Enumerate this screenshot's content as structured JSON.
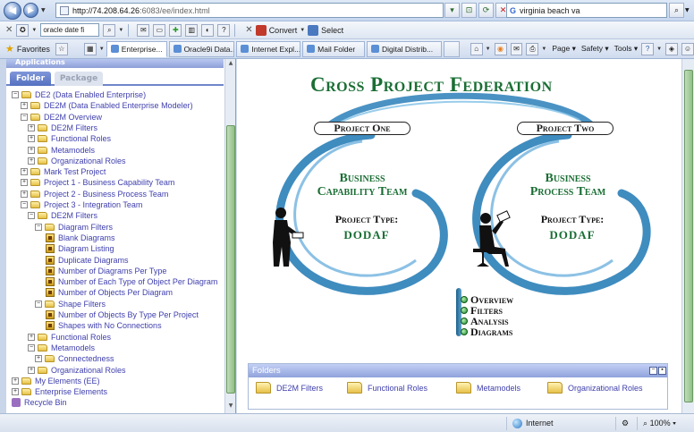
{
  "browser": {
    "address": {
      "host": "http://74.208.64.26",
      "rest": ":6083/ee/index.html"
    },
    "search_value": "virginia beach va",
    "search_logo": "G",
    "toolbar": {
      "search_value": "oracle date fi",
      "convert_label": "Convert",
      "select_label": "Select"
    },
    "favorites_label": "Favorites",
    "tabs": [
      {
        "label": "Enterprise...",
        "active": true
      },
      {
        "label": "Oracle9i Data..."
      },
      {
        "label": "Internet Expl..."
      },
      {
        "label": "Mail Folder"
      },
      {
        "label": "Digital Distrib..."
      }
    ],
    "commands": {
      "page": "Page",
      "safety": "Safety",
      "tools": "Tools"
    },
    "status": {
      "zone": "Internet",
      "zoom": "100%"
    }
  },
  "left_panel": {
    "header": "Applications",
    "tabs": {
      "folder": "Folder",
      "package": "Package"
    },
    "tree": [
      {
        "label": "DE2 (Data Enabled Enterprise)",
        "level": 0,
        "exp": "−",
        "icon": "folder"
      },
      {
        "label": "DE2M (Data Enabled Enterprise Modeler)",
        "level": 1,
        "exp": "+",
        "icon": "folder"
      },
      {
        "label": "DE2M Overview",
        "level": 1,
        "exp": "−",
        "icon": "folder"
      },
      {
        "label": "DE2M Filters",
        "level": 2,
        "exp": "+",
        "icon": "folder"
      },
      {
        "label": "Functional Roles",
        "level": 2,
        "exp": "+",
        "icon": "folder"
      },
      {
        "label": "Metamodels",
        "level": 2,
        "exp": "+",
        "icon": "folder"
      },
      {
        "label": "Organizational Roles",
        "level": 2,
        "exp": "+",
        "icon": "folder"
      },
      {
        "label": "Mark Test Project",
        "level": 1,
        "exp": "+",
        "icon": "folder"
      },
      {
        "label": "Project 1 - Business Capability Team",
        "level": 1,
        "exp": "+",
        "icon": "folder"
      },
      {
        "label": "Project 2 - Business Process Team",
        "level": 1,
        "exp": "+",
        "icon": "folder"
      },
      {
        "label": "Project 3 - Integration Team",
        "level": 1,
        "exp": "−",
        "icon": "folder"
      },
      {
        "label": "DE2M Filters",
        "level": 2,
        "exp": "−",
        "icon": "folder"
      },
      {
        "label": "Diagram Filters",
        "level": 3,
        "exp": "−",
        "icon": "folder"
      },
      {
        "label": "Blank Diagrams",
        "level": 4,
        "exp": "",
        "icon": "report"
      },
      {
        "label": "Diagram Listing",
        "level": 4,
        "exp": "",
        "icon": "report"
      },
      {
        "label": "Duplicate Diagrams",
        "level": 4,
        "exp": "",
        "icon": "report"
      },
      {
        "label": "Number of Diagrams Per Type",
        "level": 4,
        "exp": "",
        "icon": "report"
      },
      {
        "label": "Number of Each Type of Object Per Diagram",
        "level": 4,
        "exp": "",
        "icon": "report"
      },
      {
        "label": "Number of Objects Per Diagram",
        "level": 4,
        "exp": "",
        "icon": "report"
      },
      {
        "label": "Shape Filters",
        "level": 3,
        "exp": "−",
        "icon": "folder"
      },
      {
        "label": "Number of Objects By Type Per Project",
        "level": 4,
        "exp": "",
        "icon": "report"
      },
      {
        "label": "Shapes with No Connections",
        "level": 4,
        "exp": "",
        "icon": "report"
      },
      {
        "label": "Functional Roles",
        "level": 2,
        "exp": "+",
        "icon": "folder"
      },
      {
        "label": "Metamodels",
        "level": 2,
        "exp": "−",
        "icon": "folder"
      },
      {
        "label": "Connectedness",
        "level": 3,
        "exp": "+",
        "icon": "folder"
      },
      {
        "label": "Organizational Roles",
        "level": 2,
        "exp": "+",
        "icon": "folder"
      },
      {
        "label": "My Elements (EE)",
        "level": 0,
        "exp": "+",
        "icon": "folder"
      },
      {
        "label": "Enterprise Elements",
        "level": 0,
        "exp": "+",
        "icon": "folder"
      },
      {
        "label": "Recycle Bin",
        "level": 0,
        "exp": "",
        "icon": "bin"
      }
    ]
  },
  "main": {
    "title": "Cross Project Federation",
    "project_one": {
      "label": "Project One",
      "team_line1": "Business",
      "team_line2": "Capability Team",
      "type_label": "Project Type:",
      "type_value": "DODAF"
    },
    "project_two": {
      "label": "Project Two",
      "team_line1": "Business",
      "team_line2": "Process Team",
      "type_label": "Project Type:",
      "type_value": "DODAF"
    },
    "links": [
      "Overview",
      "Filters",
      "Analysis",
      "Diagrams"
    ],
    "folders_panel": {
      "header": "Folders",
      "items": [
        "DE2M Filters",
        "Functional Roles",
        "Metamodels",
        "Organizational Roles"
      ]
    },
    "colors": {
      "brand_green": "#1a6e34",
      "swirl_blue": "#2a7fb8"
    }
  }
}
